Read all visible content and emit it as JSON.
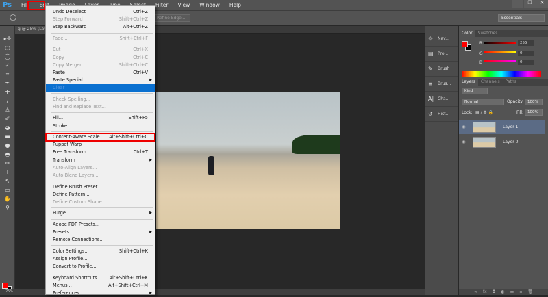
{
  "app": {
    "logo": "Ps",
    "menus": [
      "File",
      "Edit",
      "Image",
      "Layer",
      "Type",
      "Select",
      "Filter",
      "View",
      "Window",
      "Help"
    ],
    "active_menu": "Edit",
    "window_controls": [
      "–",
      "❐",
      "✕"
    ]
  },
  "options": {
    "refine_edge": "Refine Edge...",
    "workspace": "Essentials"
  },
  "document": {
    "tab": "g @ 25% (Lay",
    "zoom": "25%"
  },
  "edit_menu": [
    {
      "label": "Undo Deselect",
      "shortcut": "Ctrl+Z"
    },
    {
      "label": "Step Forward",
      "shortcut": "Shift+Ctrl+Z",
      "disabled": true
    },
    {
      "label": "Step Backward",
      "shortcut": "Alt+Ctrl+Z"
    },
    {
      "sep": true
    },
    {
      "label": "Fade...",
      "shortcut": "Shift+Ctrl+F",
      "disabled": true
    },
    {
      "sep": true
    },
    {
      "label": "Cut",
      "shortcut": "Ctrl+X",
      "disabled": true
    },
    {
      "label": "Copy",
      "shortcut": "Ctrl+C",
      "disabled": true
    },
    {
      "label": "Copy Merged",
      "shortcut": "Shift+Ctrl+C",
      "disabled": true
    },
    {
      "label": "Paste",
      "shortcut": "Ctrl+V"
    },
    {
      "label": "Paste Special",
      "submenu": true
    },
    {
      "label": "Clear",
      "highlighted": true
    },
    {
      "sep": true
    },
    {
      "label": "Check Spelling...",
      "disabled": true
    },
    {
      "label": "Find and Replace Text...",
      "disabled": true
    },
    {
      "sep": true
    },
    {
      "label": "Fill...",
      "shortcut": "Shift+F5"
    },
    {
      "label": "Stroke..."
    },
    {
      "sep": true
    },
    {
      "label": "Content-Aware Scale",
      "shortcut": "Alt+Shift+Ctrl+C",
      "boxed": true
    },
    {
      "label": "Puppet Warp"
    },
    {
      "label": "Free Transform",
      "shortcut": "Ctrl+T"
    },
    {
      "label": "Transform",
      "submenu": true
    },
    {
      "label": "Auto-Align Layers...",
      "disabled": true
    },
    {
      "label": "Auto-Blend Layers...",
      "disabled": true
    },
    {
      "sep": true
    },
    {
      "label": "Define Brush Preset..."
    },
    {
      "label": "Define Pattern..."
    },
    {
      "label": "Define Custom Shape...",
      "disabled": true
    },
    {
      "sep": true
    },
    {
      "label": "Purge",
      "submenu": true
    },
    {
      "sep": true
    },
    {
      "label": "Adobe PDF Presets..."
    },
    {
      "label": "Presets",
      "submenu": true
    },
    {
      "label": "Remote Connections..."
    },
    {
      "sep": true
    },
    {
      "label": "Color Settings...",
      "shortcut": "Shift+Ctrl+K"
    },
    {
      "label": "Assign Profile..."
    },
    {
      "label": "Convert to Profile..."
    },
    {
      "sep": true
    },
    {
      "label": "Keyboard Shortcuts...",
      "shortcut": "Alt+Shift+Ctrl+K"
    },
    {
      "label": "Menus...",
      "shortcut": "Alt+Shift+Ctrl+M"
    },
    {
      "label": "Preferences",
      "submenu": true
    }
  ],
  "dock": [
    {
      "icon": "☼",
      "label": "Nav..."
    },
    {
      "icon": "▤",
      "label": "Pro..."
    },
    {
      "icon": "✎",
      "label": "Brush"
    },
    {
      "icon": "≡",
      "label": "Brus..."
    },
    {
      "icon": "A|",
      "label": "Cha..."
    },
    {
      "icon": "↺",
      "label": "Hist..."
    }
  ],
  "color_panel": {
    "tabs": [
      "Color",
      "Swatches"
    ],
    "channels": [
      {
        "name": "R",
        "value": "255"
      },
      {
        "name": "G",
        "value": "0"
      },
      {
        "name": "B",
        "value": "0"
      }
    ],
    "foreground": "#ff0000",
    "background": "#000000"
  },
  "layers_panel": {
    "tabs": [
      "Layers",
      "Channels",
      "Paths"
    ],
    "filter": "Kind",
    "blend_mode": "Normal",
    "opacity_label": "Opacity:",
    "opacity": "100%",
    "lock_label": "Lock:",
    "fill_label": "Fill:",
    "fill": "100%",
    "layers": [
      {
        "name": "Layer 1",
        "selected": true
      },
      {
        "name": "Layer 0"
      }
    ],
    "footer_icons": [
      "∞",
      "fx",
      "◘",
      "◐",
      "▬",
      "▫",
      "🗑"
    ]
  }
}
